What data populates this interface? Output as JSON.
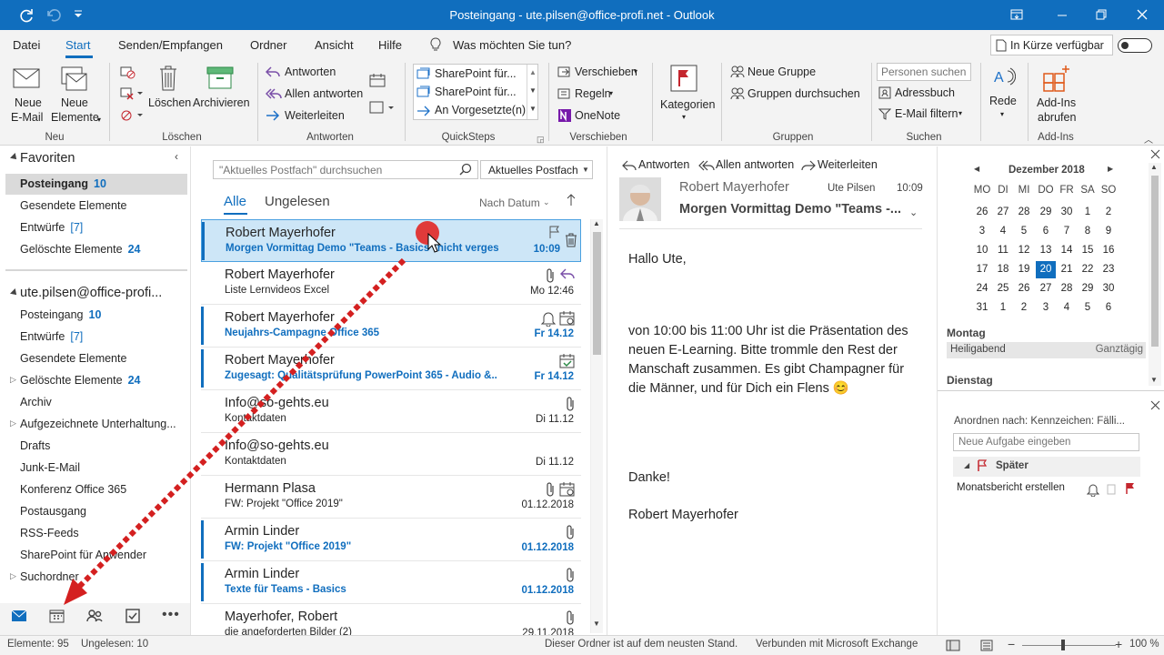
{
  "window": {
    "title": "Posteingang - ute.pilsen@office-profi.net - Outlook"
  },
  "menu": {
    "items": [
      "Datei",
      "Start",
      "Senden/Empfangen",
      "Ordner",
      "Ansicht",
      "Hilfe"
    ],
    "tellme": "Was möchten Sie tun?",
    "coming_soon": "In Kürze verfügbar"
  },
  "ribbon": {
    "neu": {
      "new_email": [
        "Neue",
        "E-Mail"
      ],
      "new_items": [
        "Neue",
        "Elemente"
      ],
      "group": "Neu"
    },
    "loeschen": {
      "delete": "Löschen",
      "archive": "Archivieren",
      "group": "Löschen"
    },
    "antworten": {
      "reply": "Antworten",
      "reply_all": "Allen antworten",
      "forward": "Weiterleiten",
      "group": "Antworten"
    },
    "quicksteps": {
      "items": [
        "SharePoint für...",
        "SharePoint für...",
        "An Vorgesetzte(n)"
      ],
      "group": "QuickSteps"
    },
    "verschieben": {
      "move": "Verschieben",
      "rules": "Regeln",
      "onenote": "OneNote",
      "group": "Verschieben"
    },
    "kategorien": {
      "label": "Kategorien"
    },
    "gruppen": {
      "new_group": "Neue Gruppe",
      "browse_groups": "Gruppen durchsuchen",
      "group": "Gruppen"
    },
    "suchen": {
      "people_placeholder": "Personen suchen",
      "address_book": "Adressbuch",
      "filter": "E-Mail filtern",
      "group": "Suchen"
    },
    "rede": {
      "label": "Rede"
    },
    "addins": {
      "label": [
        "Add-Ins",
        "abrufen"
      ],
      "group": "Add-Ins"
    }
  },
  "nav": {
    "favorites_title": "Favoriten",
    "favorites": [
      {
        "label": "Posteingang",
        "count": "10"
      },
      {
        "label": "Gesendete Elemente",
        "count": ""
      },
      {
        "label": "Entwürfe",
        "count": "[7]"
      },
      {
        "label": "Gelöschte Elemente",
        "count": "24"
      }
    ],
    "account_title": "ute.pilsen@office-profi...",
    "folders": [
      {
        "label": "Posteingang",
        "count": "10"
      },
      {
        "label": "Entwürfe",
        "count": "[7]"
      },
      {
        "label": "Gesendete Elemente",
        "count": ""
      },
      {
        "label": "Gelöschte Elemente",
        "count": "24"
      },
      {
        "label": "Archiv",
        "count": ""
      },
      {
        "label": "Aufgezeichnete Unterhaltung...",
        "count": ""
      },
      {
        "label": "Drafts",
        "count": ""
      },
      {
        "label": "Junk-E-Mail",
        "count": ""
      },
      {
        "label": "Konferenz Office 365",
        "count": ""
      },
      {
        "label": "Postausgang",
        "count": ""
      },
      {
        "label": "RSS-Feeds",
        "count": ""
      },
      {
        "label": "SharePoint für Anwender",
        "count": ""
      },
      {
        "label": "Suchordner",
        "count": ""
      }
    ]
  },
  "list": {
    "search_placeholder": "\"Aktuelles Postfach\" durchsuchen",
    "scope": "Aktuelles Postfach",
    "tab_all": "Alle",
    "tab_unread": "Ungelesen",
    "sort": "Nach Datum",
    "messages": [
      {
        "sender": "Robert Mayerhofer",
        "subject": "Morgen Vormittag Demo \"Teams - Basics\" nicht verges...",
        "date": "10:09"
      },
      {
        "sender": "Robert Mayerhofer",
        "subject": "Liste Lernvideos Excel",
        "date": "Mo 12:46"
      },
      {
        "sender": "Robert Mayerhofer",
        "subject": "Neujahrs-Campagne Office 365",
        "date": "Fr 14.12"
      },
      {
        "sender": "Robert Mayerhofer",
        "subject": "Zugesagt: Qualitätsprüfung PowerPoint 365 - Audio &...",
        "date": "Fr 14.12"
      },
      {
        "sender": "Info@so-gehts.eu",
        "subject": "Kontaktdaten",
        "date": "Di 11.12"
      },
      {
        "sender": "Info@so-gehts.eu",
        "subject": "Kontaktdaten",
        "date": "Di 11.12"
      },
      {
        "sender": "Hermann Plasa",
        "subject": "FW: Projekt \"Office 2019\"",
        "date": "01.12.2018"
      },
      {
        "sender": "Armin Linder",
        "subject": "FW: Projekt \"Office 2019\"",
        "date": "01.12.2018"
      },
      {
        "sender": "Armin Linder",
        "subject": "Texte für Teams - Basics",
        "date": "01.12.2018"
      },
      {
        "sender": "Mayerhofer, Robert",
        "subject": "die angeforderten Bilder (2)",
        "date": "29.11.2018"
      }
    ]
  },
  "reading": {
    "reply": "Antworten",
    "reply_all": "Allen antworten",
    "forward": "Weiterleiten",
    "from": "Robert Mayerhofer",
    "to": "Ute Pilsen",
    "time": "10:09",
    "subject": "Morgen Vormittag Demo \"Teams -...",
    "greeting": "Hallo Ute,",
    "paragraph": "von 10:00 bis 11:00 Uhr ist die Präsentation des neuen E-Learning. Bitte trommle den Rest der Manschaft zusammen. Es gibt Champagner für die Männer, und für Dich ein Flens 😊",
    "thanks": "Danke!",
    "signature": "Robert Mayerhofer"
  },
  "calendar": {
    "month": "Dezember 2018",
    "weekdays": [
      "MO",
      "DI",
      "MI",
      "DO",
      "FR",
      "SA",
      "SO"
    ],
    "weeks": [
      [
        "26",
        "27",
        "28",
        "29",
        "30",
        "1",
        "2"
      ],
      [
        "3",
        "4",
        "5",
        "6",
        "7",
        "8",
        "9"
      ],
      [
        "10",
        "11",
        "12",
        "13",
        "14",
        "15",
        "16"
      ],
      [
        "17",
        "18",
        "19",
        "20",
        "21",
        "22",
        "23"
      ],
      [
        "24",
        "25",
        "26",
        "27",
        "28",
        "29",
        "30"
      ],
      [
        "31",
        "1",
        "2",
        "3",
        "4",
        "5",
        "6"
      ]
    ],
    "today": "20",
    "day1": "Montag",
    "event": "Heiligabend",
    "event_time": "Ganztägig",
    "day2": "Dienstag"
  },
  "tasks": {
    "arrange": "Anordnen nach: Kennzeichen: Fälli...",
    "new_task_placeholder": "Neue Aufgabe eingeben",
    "group": "Später",
    "item": "Monatsbericht erstellen"
  },
  "status": {
    "items": "Elemente: 95",
    "unread": "Ungelesen: 10",
    "updated": "Dieser Ordner ist auf dem neusten Stand.",
    "connected": "Verbunden mit Microsoft Exchange",
    "zoom": "100 %"
  },
  "colors": {
    "accent": "#106ebe",
    "flag": "#c4262e",
    "selection": "#cde6f7"
  }
}
